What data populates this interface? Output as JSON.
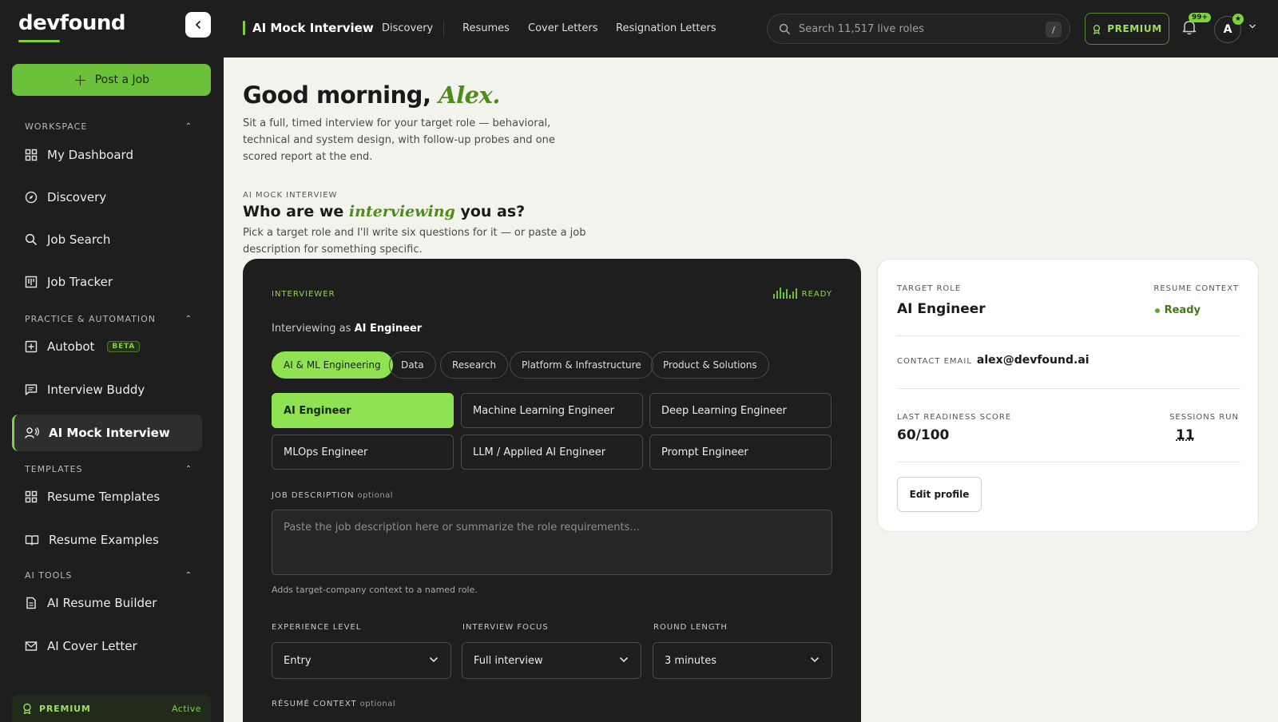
{
  "brand": {
    "name": "devfound"
  },
  "sidebar": {
    "post_job_label": "Post a Job",
    "sections": [
      {
        "title": "WORKSPACE",
        "items": [
          {
            "label": "My Dashboard",
            "icon": "dashboard-icon"
          },
          {
            "label": "Discovery",
            "icon": "compass-icon"
          },
          {
            "label": "Job Search",
            "icon": "search-icon"
          },
          {
            "label": "Job Tracker",
            "icon": "kanban-icon"
          }
        ]
      },
      {
        "title": "PRACTICE & AUTOMATION",
        "items": [
          {
            "label": "Autobot",
            "icon": "bot-icon",
            "badge": "BETA"
          },
          {
            "label": "Interview Buddy",
            "icon": "chat-icon"
          },
          {
            "label": "AI Mock Interview",
            "icon": "interview-icon",
            "active": true
          }
        ]
      },
      {
        "title": "TEMPLATES",
        "items": [
          {
            "label": "Resume Templates",
            "icon": "grid-icon"
          },
          {
            "label": "Resume Examples",
            "icon": "book-icon"
          }
        ]
      },
      {
        "title": "AI TOOLS",
        "items": [
          {
            "label": "AI Resume Builder",
            "icon": "document-icon"
          },
          {
            "label": "AI Cover Letter",
            "icon": "mail-icon"
          }
        ]
      }
    ],
    "premium": {
      "label": "PREMIUM",
      "status": "Active"
    }
  },
  "topbar": {
    "title": "AI Mock Interview",
    "links": [
      "Discovery",
      "Resumes",
      "Cover Letters",
      "Resignation Letters"
    ],
    "search_placeholder": "Search 11,517 live roles",
    "search_shortcut": "/",
    "premium_label": "PREMIUM",
    "notification_count": "99+",
    "avatar_initial": "A"
  },
  "main": {
    "greeting_prefix": "Good morning, ",
    "greeting_name": "Alex.",
    "intro": "Sit a full, timed interview for your target role — behavioral, technical and system design, with follow-up probes and one scored report at the end.",
    "eyebrow": "AI MOCK INTERVIEW",
    "who_prefix": "Who are we ",
    "who_em": "interviewing",
    "who_suffix": " you as?",
    "who_sub": "Pick a target role and I'll write six questions for it — or paste a job description for something specific."
  },
  "interviewer": {
    "label": "INTERVIEWER",
    "status": "READY",
    "interviewing_as_prefix": "Interviewing as ",
    "interviewing_as_role": "AI Engineer",
    "categories": [
      "AI & ML Engineering",
      "Data",
      "Research",
      "Platform & Infrastructure",
      "Product & Solutions"
    ],
    "selected_category": "AI & ML Engineering",
    "roles": [
      "AI Engineer",
      "Machine Learning Engineer",
      "Deep Learning Engineer",
      "MLOps Engineer",
      "LLM / Applied AI Engineer",
      "Prompt Engineer"
    ],
    "selected_role": "AI Engineer",
    "job_description_label": "JOB DESCRIPTION",
    "optional_label": "optional",
    "job_description_placeholder": "Paste the job description here or summarize the role requirements...",
    "job_description_hint": "Adds target-company context to a named role.",
    "experience_level_label": "EXPERIENCE LEVEL",
    "experience_level_value": "Entry",
    "interview_focus_label": "INTERVIEW FOCUS",
    "interview_focus_value": "Full interview",
    "round_length_label": "ROUND LENGTH",
    "round_length_value": "3 minutes",
    "resume_context_label": "RÉSUMÉ CONTEXT",
    "resume_context_optional": "optional"
  },
  "profile_panel": {
    "target_role_label": "TARGET ROLE",
    "target_role_value": "AI Engineer",
    "resume_context_label": "RESUME CONTEXT",
    "resume_context_value": "Ready",
    "contact_email_label": "CONTACT EMAIL",
    "contact_email_value": "alex@devfound.ai",
    "last_score_label": "LAST READINESS SCORE",
    "last_score_value": "60/100",
    "sessions_label": "SESSIONS RUN",
    "sessions_value": "11",
    "edit_label": "Edit profile"
  },
  "colors": {
    "accent": "#7fd33a",
    "sidebar_bg": "#1e1e1e",
    "card_bg": "#1e1e1e",
    "main_bg": "#f3f3ee"
  }
}
